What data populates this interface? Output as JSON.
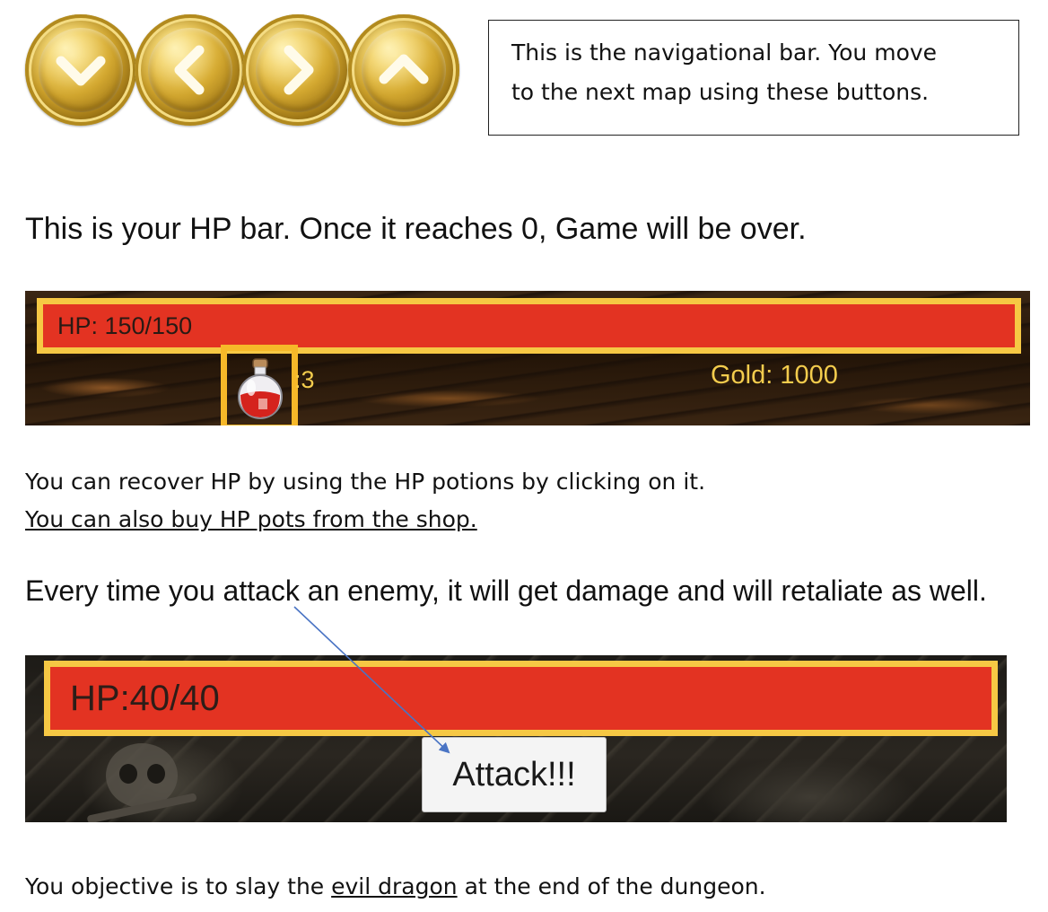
{
  "nav": {
    "buttons": [
      {
        "id": "down",
        "icon": "chevron-down-icon"
      },
      {
        "id": "left",
        "icon": "chevron-left-icon"
      },
      {
        "id": "right",
        "icon": "chevron-right-icon"
      },
      {
        "id": "up",
        "icon": "chevron-up-icon"
      }
    ],
    "callout_line1": "This is the navigational bar. You move",
    "callout_line2": "to the next map using these buttons."
  },
  "hp_section": {
    "heading": "This is your HP bar. Once it reaches 0, Game will be over.",
    "player_hp": "HP: 150/150",
    "potion_icon": "hp-potion-icon",
    "potion_count": ":3",
    "gold": "Gold: 1000",
    "recover_text": "You can recover HP by using the HP potions by clicking on it.",
    "shop_text": "You can also buy HP pots from the shop."
  },
  "attack_section": {
    "heading": "Every time you attack an enemy, it will get damage and will retaliate as well.",
    "enemy_hp": "HP:40/40",
    "attack_label": "Attack!!!"
  },
  "objective": {
    "before": "You objective is to slay the ",
    "link": "evil dragon",
    "after": " at the end of the dungeon."
  },
  "colors": {
    "hp_bar": "#e33322",
    "hp_border": "#f6c844",
    "gold_text": "#f3cc4d",
    "arrow": "#4a74c4"
  }
}
